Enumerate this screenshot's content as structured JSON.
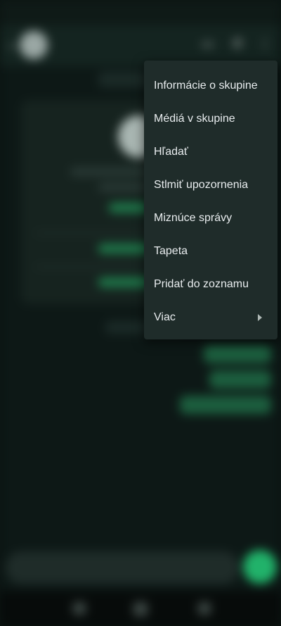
{
  "menu": {
    "items": [
      {
        "label": "Informácie o skupine"
      },
      {
        "label": "Médiá v skupine"
      },
      {
        "label": "Hľadať"
      },
      {
        "label": "Stlmiť upozornenia"
      },
      {
        "label": "Miznúce správy"
      },
      {
        "label": "Tapeta"
      },
      {
        "label": "Pridať do zoznamu"
      },
      {
        "label": "Viac",
        "has_submenu": true,
        "submenu_icon": "chevron-right-icon"
      }
    ]
  },
  "colors": {
    "background": "#0b1412",
    "menu_background": "#1f2c2a",
    "menu_text": "#e9edef",
    "accent_green": "#21b26a"
  }
}
